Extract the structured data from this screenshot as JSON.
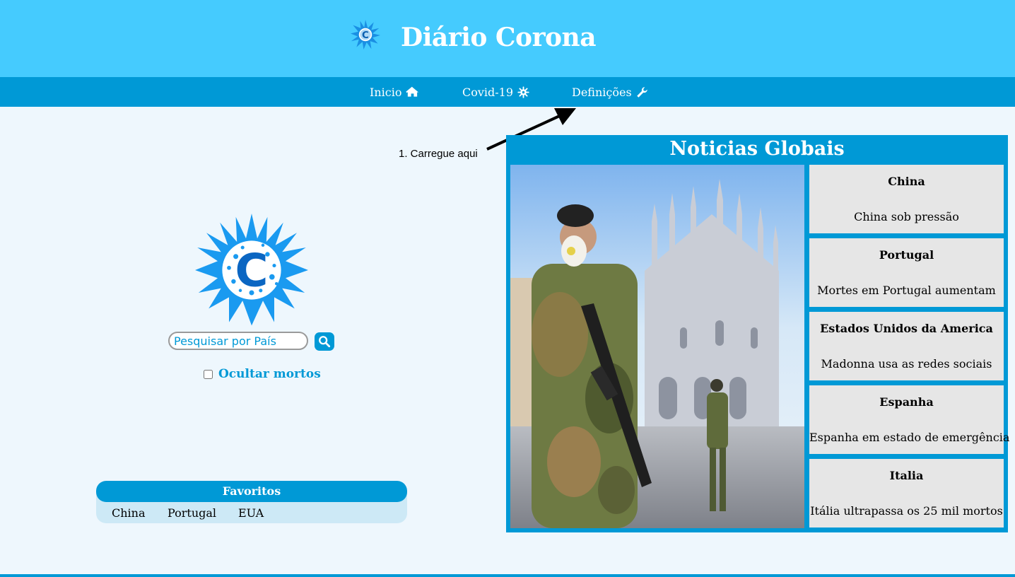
{
  "header": {
    "title": "Diário Corona"
  },
  "nav": {
    "items": [
      {
        "label": "Inicio",
        "icon": "home-icon"
      },
      {
        "label": "Covid-19",
        "icon": "virus-icon"
      },
      {
        "label": "Definições",
        "icon": "wrench-icon"
      }
    ]
  },
  "annotation": {
    "text": "1. Carregue aqui"
  },
  "search": {
    "placeholder": "Pesquisar por País"
  },
  "hide_dead": {
    "label": "Ocultar mortos",
    "checked": false
  },
  "favorites": {
    "title": "Favoritos",
    "items": [
      "China",
      "Portugal",
      "EUA"
    ]
  },
  "news": {
    "title": "Noticias Globais",
    "items": [
      {
        "country": "China",
        "headline": "China sob pressão"
      },
      {
        "country": "Portugal",
        "headline": "Mortes em Portugal aumentam"
      },
      {
        "country": "Estados Unidos da America",
        "headline": "Madonna usa as redes sociais"
      },
      {
        "country": "Espanha",
        "headline": "Espanha em estado de emergência"
      },
      {
        "country": "Italia",
        "headline": "Itália ultrapassa os 25 mil mortos"
      }
    ]
  },
  "colors": {
    "header_bg": "#45cbfe",
    "nav_bg": "#0099d6",
    "page_bg": "#eef7fd",
    "accent": "#0099d6",
    "card_bg": "#e6e6e6"
  }
}
